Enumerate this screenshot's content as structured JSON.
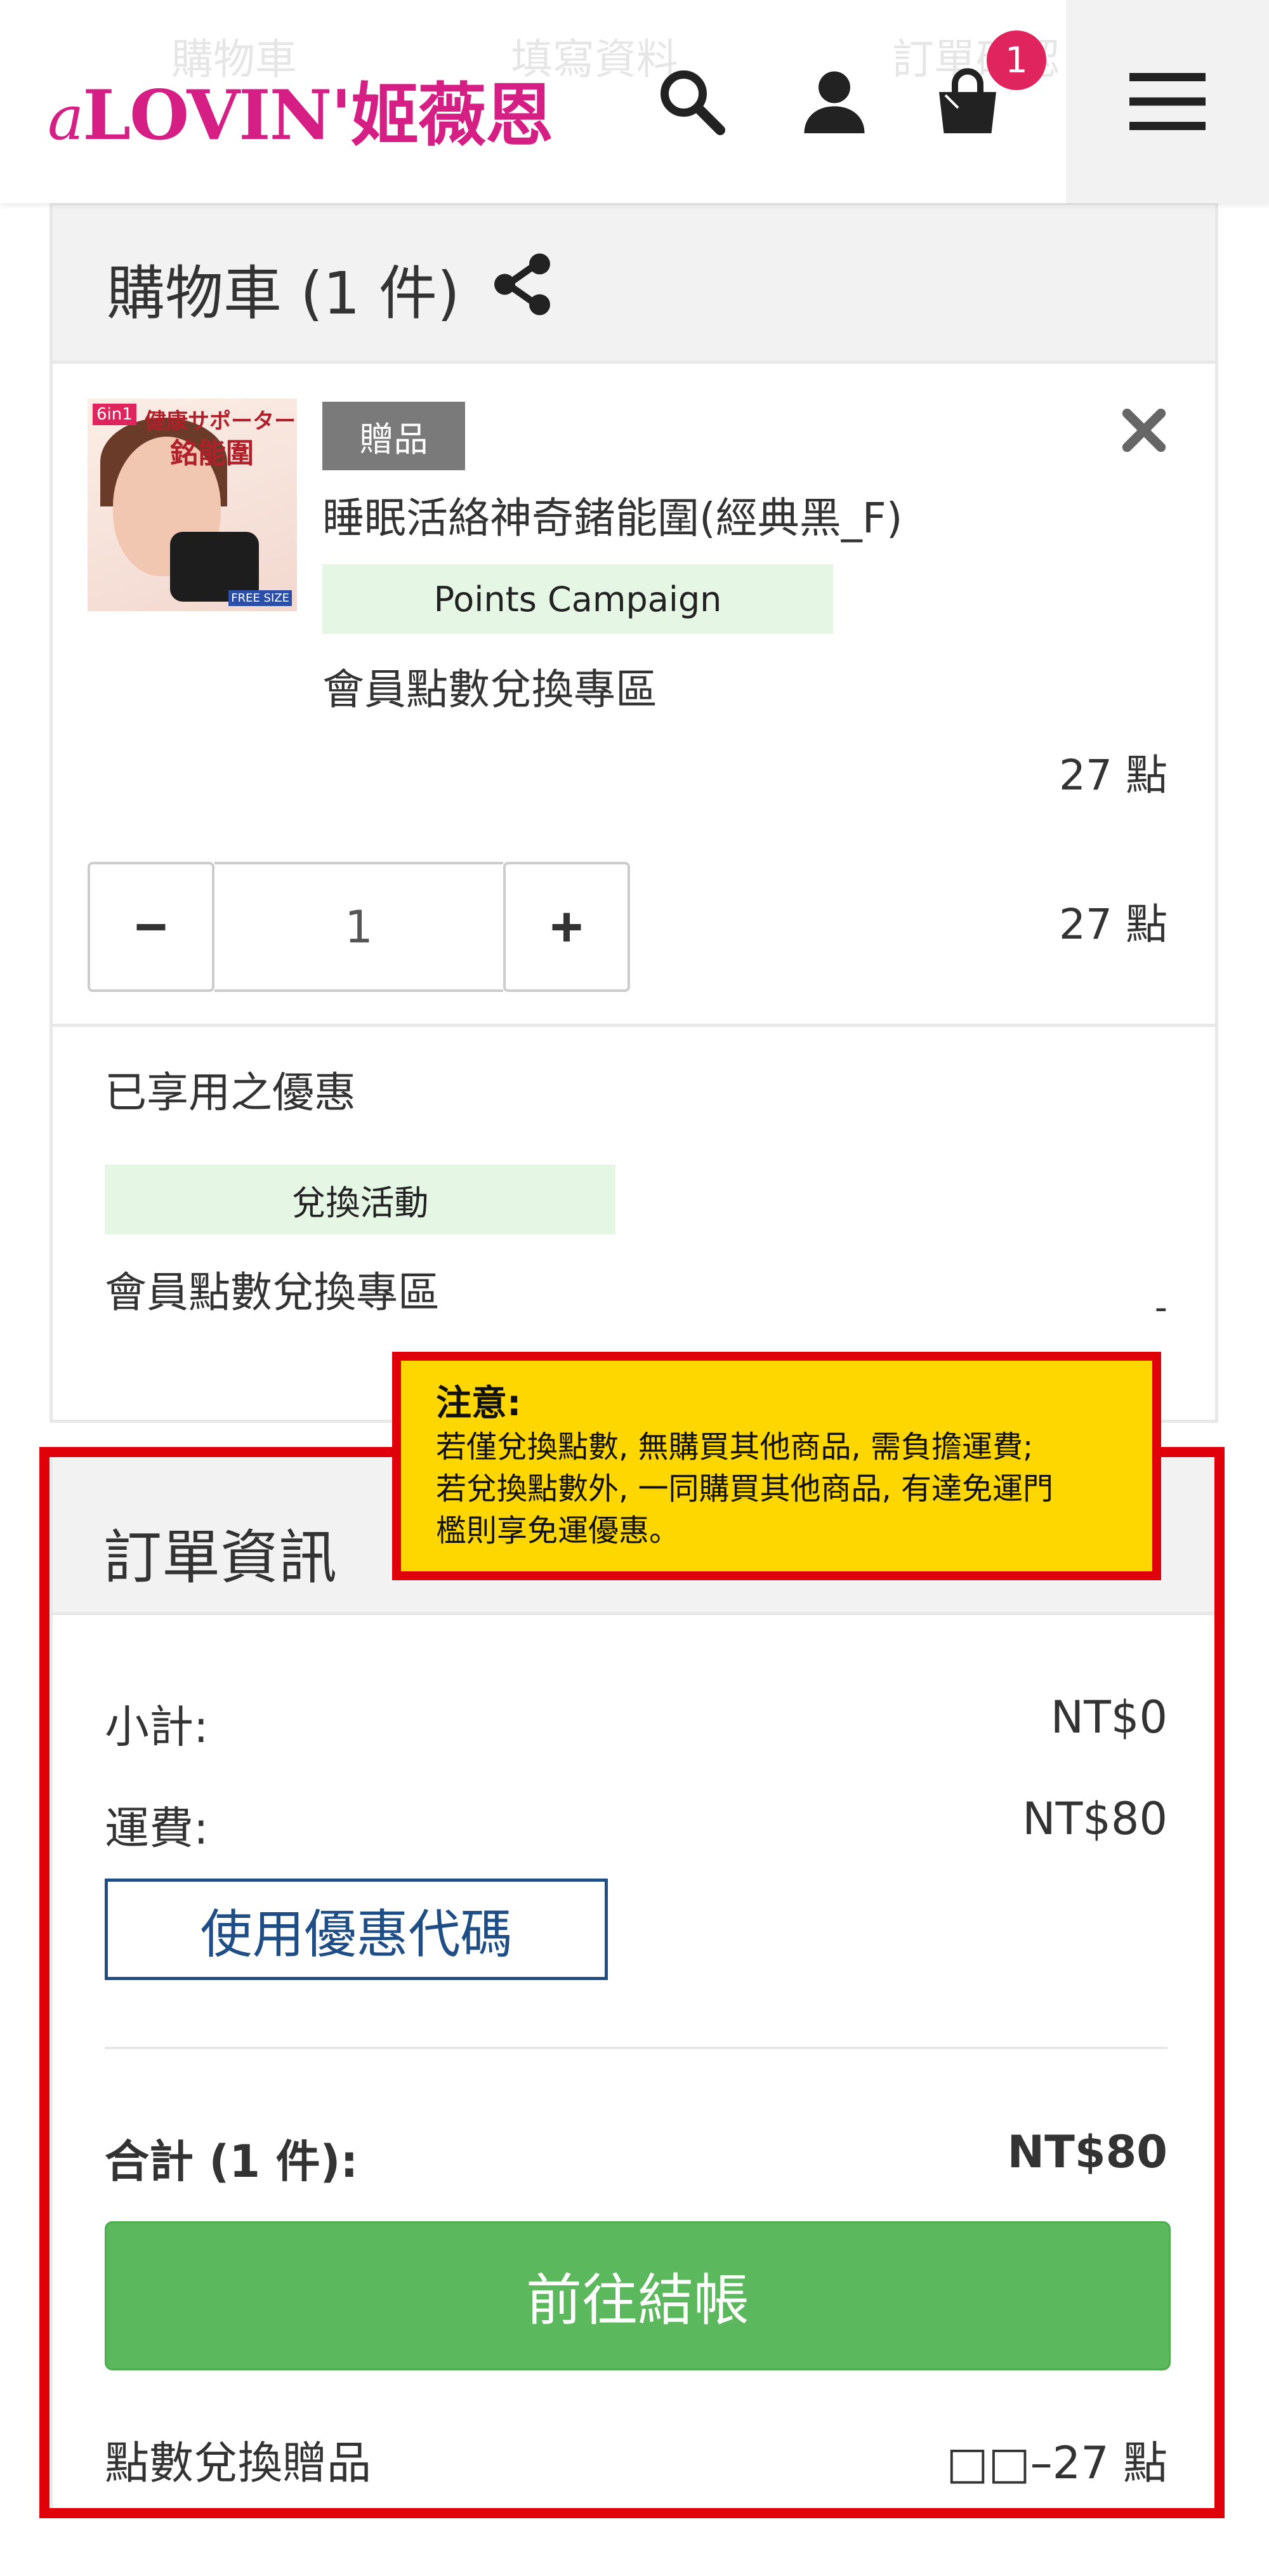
{
  "header": {
    "steps": [
      "購物車",
      "填寫資料",
      "訂單確認"
    ],
    "logo": "LOVIN'姬薇恩",
    "logo_prefix": "a",
    "cart_count": "1",
    "icons": [
      "search-icon",
      "user-icon",
      "shopping-bag-icon",
      "menu-icon"
    ]
  },
  "cart": {
    "title": "購物車 (1 件)",
    "item": {
      "gift_label": "贈品",
      "image_text": {
        "tag": "6in1",
        "line1": "健康サポーター",
        "line2": "銘能圍",
        "size": "FREE SIZE"
      },
      "name": "睡眠活絡神奇鍺能圍(經典黑_F)",
      "campaign_tag": "Points Campaign",
      "campaign_desc": "會員點數兌換專區",
      "unit_points": "27 點",
      "quantity": "1",
      "line_points": "27 點"
    },
    "applied": {
      "title": "已享用之優惠",
      "tag": "兌換活動",
      "desc": "會員點數兌換專區",
      "value": "-"
    }
  },
  "notice": {
    "title": "注意:",
    "lines": [
      "若僅兌換點數, 無購買其他商品, 需負擔運費;",
      "若兌換點數外, 一同購買其他商品, 有達免運門",
      "檻則享免運優惠。"
    ]
  },
  "order": {
    "title": "訂單資訊",
    "subtotal_label": "小計:",
    "subtotal_value": "NT$0",
    "shipping_label": "運費:",
    "shipping_value": "NT$80",
    "coupon_button": "使用優惠代碼",
    "total_label": "合計 (1 件):",
    "total_value": "NT$80",
    "checkout_button": "前往結帳",
    "points_label": "點數兌換贈品",
    "points_value": "□□–27 點"
  },
  "colors": {
    "brand": "#d61f85",
    "badge": "#e0245e",
    "highlight_border": "#e0000a",
    "notice_bg": "#ffd700",
    "checkout": "#5cb85c",
    "coupon": "#1f4e86",
    "campaign_bg": "#e5f6e5"
  }
}
